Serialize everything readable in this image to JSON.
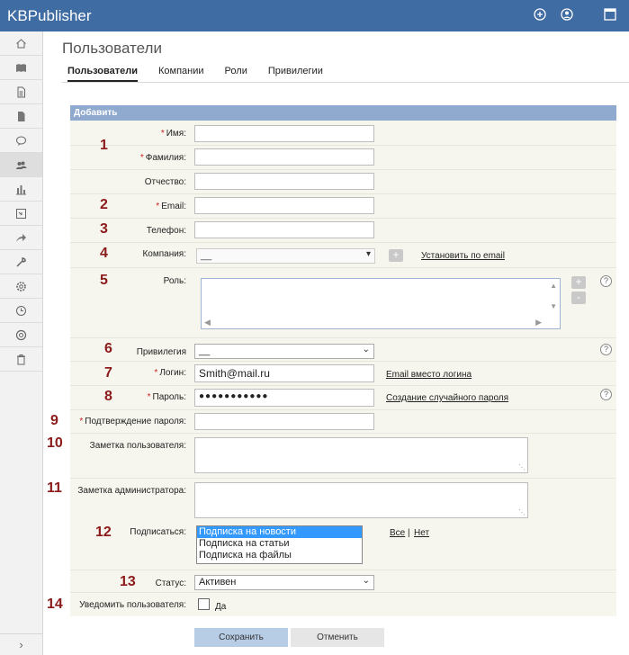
{
  "app": {
    "title": "KBPublisher"
  },
  "page": {
    "title": "Пользователи"
  },
  "tabs": [
    "Пользователи",
    "Компании",
    "Роли",
    "Привилегии"
  ],
  "panel": {
    "header": "Добавить"
  },
  "numbers": [
    "1",
    "2",
    "3",
    "4",
    "5",
    "6",
    "7",
    "8",
    "9",
    "10",
    "11",
    "12",
    "13",
    "14"
  ],
  "form": {
    "first_name": {
      "label": "Имя:",
      "value": ""
    },
    "last_name": {
      "label": "Фамилия:",
      "value": ""
    },
    "middle_name": {
      "label": "Отчество:",
      "value": ""
    },
    "email": {
      "label": "Email:",
      "value": ""
    },
    "phone": {
      "label": "Телефон:",
      "value": ""
    },
    "company": {
      "label": "Компания:",
      "value": "__",
      "add": "+",
      "link": "Установить по email"
    },
    "role": {
      "label": "Роль:",
      "add": "+",
      "remove": "-"
    },
    "privilege": {
      "label": "Привилегия",
      "value": "__"
    },
    "login": {
      "label": "Логин:",
      "value": "Smith@mail.ru",
      "link": "Email вместо логина"
    },
    "password": {
      "label": "Пароль:",
      "value": "●●●●●●●●●●●",
      "link": "Создание случайного пароля"
    },
    "password_confirm": {
      "label": "Подтверждение пароля:",
      "value": ""
    },
    "user_note": {
      "label": "Заметка пользователя:"
    },
    "admin_note": {
      "label": "Заметка администратора:"
    },
    "subscribe": {
      "label": "Подписаться:",
      "options": [
        "Подписка на новости",
        "Подписка на статьи",
        "Подписка на файлы"
      ],
      "selected_index": 0,
      "all": "Все",
      "separator": "|",
      "none": "Нет"
    },
    "status": {
      "label": "Статус:",
      "value": "Активен"
    },
    "notify": {
      "label": "Уведомить пользователя:",
      "option": "Да",
      "checked": false
    }
  },
  "help_mark": "?",
  "required_mark": "*",
  "buttons": {
    "save": "Сохранить",
    "cancel": "Отменить"
  },
  "sidebar_icons": [
    "home-icon",
    "book-icon",
    "document-icon",
    "file-icon",
    "comments-icon",
    "users-icon",
    "chart-icon",
    "import-icon",
    "share-icon",
    "tools-icon",
    "settings-icon",
    "history-icon",
    "help-icon",
    "trash-icon"
  ],
  "colors": {
    "topbar": "#3f6ca3",
    "panel_header": "#8fa9cf",
    "number": "#8b1a1a",
    "required": "#cc2222"
  }
}
